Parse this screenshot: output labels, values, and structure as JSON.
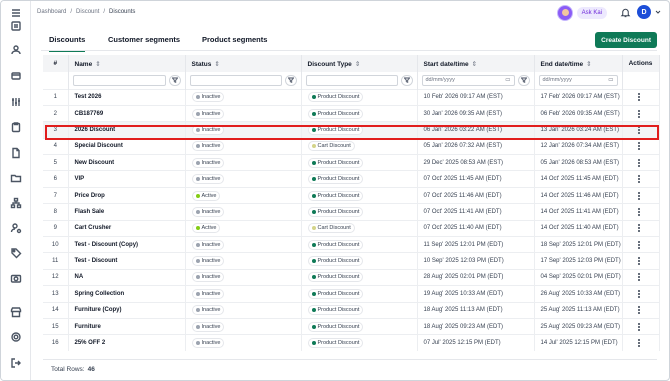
{
  "breadcrumb": [
    "Dashboard",
    "Discount",
    "Discounts"
  ],
  "header": {
    "assistant_label": "Ask Kai",
    "user_initial": "D"
  },
  "tabs": [
    {
      "label": "Discounts",
      "active": true
    },
    {
      "label": "Customer segments",
      "active": false
    },
    {
      "label": "Product segments",
      "active": false
    }
  ],
  "create_button": "Create Discount",
  "columns": {
    "num": "#",
    "name": "Name",
    "status": "Status",
    "type": "Discount Type",
    "start": "Start date/time",
    "end": "End date/time",
    "actions": "Actions"
  },
  "filters": {
    "start_placeholder": "dd/mm/yyyy",
    "end_placeholder": "dd/mm/yyyy"
  },
  "status_colors": {
    "Inactive": "#9ca3af",
    "Active": "#84cc16"
  },
  "type_colors": {
    "Product Discount": "#0f7a57",
    "Cart Discount": "#d4d48a"
  },
  "rows": [
    {
      "num": "1",
      "name": "Test 2026",
      "status": "Inactive",
      "type": "Product Discount",
      "start": "10 Feb' 2026 09:17 AM (EST)",
      "end": "17 Feb' 2026 09:17 AM (EST)"
    },
    {
      "num": "2",
      "name": "CB187769",
      "status": "Inactive",
      "type": "Product Discount",
      "start": "30 Jan' 2026 09:35 AM (EST)",
      "end": "06 Feb' 2026 09:35 AM (EST)"
    },
    {
      "num": "3",
      "name": "2026 Discount",
      "status": "Inactive",
      "type": "Product Discount",
      "start": "06 Jan' 2026 03:22 AM (EST)",
      "end": "13 Jan' 2026 03:24 AM (EST)",
      "selected": true
    },
    {
      "num": "4",
      "name": "Special Discount",
      "status": "Inactive",
      "type": "Cart Discount",
      "start": "05 Jan' 2026 07:32 AM (EST)",
      "end": "12 Jan' 2026 07:34 AM (EST)"
    },
    {
      "num": "5",
      "name": "New Discount",
      "status": "Inactive",
      "type": "Product Discount",
      "start": "29 Dec' 2025 08:53 AM (EST)",
      "end": "05 Jan' 2026 08:53 AM (EST)"
    },
    {
      "num": "6",
      "name": "VIP",
      "status": "Inactive",
      "type": "Product Discount",
      "start": "07 Oct' 2025 11:45 AM (EDT)",
      "end": "14 Oct' 2025 11:45 AM (EDT)"
    },
    {
      "num": "7",
      "name": "Price Drop",
      "status": "Active",
      "type": "Product Discount",
      "start": "07 Oct' 2025 11:46 AM (EDT)",
      "end": "14 Oct' 2025 11:46 AM (EDT)"
    },
    {
      "num": "8",
      "name": "Flash Sale",
      "status": "Inactive",
      "type": "Product Discount",
      "start": "07 Oct' 2025 11:41 AM (EDT)",
      "end": "14 Oct' 2025 11:41 AM (EDT)"
    },
    {
      "num": "9",
      "name": "Cart Crusher",
      "status": "Active",
      "type": "Cart Discount",
      "start": "07 Oct' 2025 11:40 AM (EDT)",
      "end": "14 Oct' 2025 11:40 AM (EDT)"
    },
    {
      "num": "10",
      "name": "Test - Discount (Copy)",
      "status": "Inactive",
      "type": "Product Discount",
      "start": "11 Sep' 2025 12:01 PM (EDT)",
      "end": "18 Sep' 2025 12:01 PM (EDT)"
    },
    {
      "num": "11",
      "name": "Test - Discount",
      "status": "Inactive",
      "type": "Product Discount",
      "start": "10 Sep' 2025 12:03 PM (EDT)",
      "end": "17 Sep' 2025 12:03 PM (EDT)"
    },
    {
      "num": "12",
      "name": "NA",
      "status": "Inactive",
      "type": "Product Discount",
      "start": "28 Aug' 2025 02:01 PM (EDT)",
      "end": "04 Sep' 2025 02:01 PM (EDT)"
    },
    {
      "num": "13",
      "name": "Spring Collection",
      "status": "Inactive",
      "type": "Product Discount",
      "start": "19 Aug' 2025 10:33 AM (EDT)",
      "end": "26 Aug' 2025 10:33 AM (EDT)"
    },
    {
      "num": "14",
      "name": "Furniture (Copy)",
      "status": "Inactive",
      "type": "Product Discount",
      "start": "18 Aug' 2025 11:13 AM (EDT)",
      "end": "25 Aug' 2025 11:13 AM (EDT)"
    },
    {
      "num": "15",
      "name": "Furniture",
      "status": "Inactive",
      "type": "Product Discount",
      "start": "18 Aug' 2025 09:23 AM (EDT)",
      "end": "25 Aug' 2025 09:23 AM (EDT)"
    },
    {
      "num": "16",
      "name": "25% OFF 2",
      "status": "Inactive",
      "type": "Product Discount",
      "start": "07 Jul' 2025 12:15 PM (EDT)",
      "end": "14 Jul' 2025 12:15 PM (EDT)"
    }
  ],
  "footer": {
    "label": "Total Rows:",
    "count": "46"
  }
}
